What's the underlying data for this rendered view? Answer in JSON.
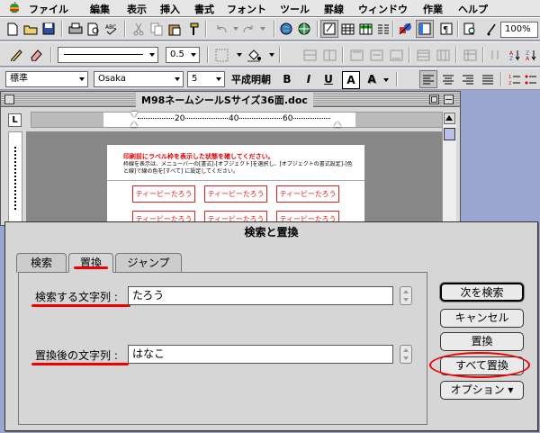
{
  "menubar": {
    "items": [
      "ファイル",
      "編集",
      "表示",
      "挿入",
      "書式",
      "フォント",
      "ツール",
      "罫線",
      "ウィンドウ",
      "作業",
      "ヘルプ"
    ]
  },
  "toolbar1": {
    "zoom": "100%"
  },
  "toolbar2": {
    "line_weight": "0.5"
  },
  "toolbar3": {
    "style": "標準",
    "font": "Osaka",
    "font_size": "5",
    "mincho_font": "平成明朝",
    "bold": "B",
    "italic": "I",
    "underline": "U",
    "outline": "A",
    "shadow": "A"
  },
  "document": {
    "title": "M98ネームシールSサイズ36面.doc",
    "instruction_line1": "印刷前にラベル枠を表示した状態を確してください。",
    "instruction_line2": "枠線を表示は、メニューバーの[書式]-[オブジェクト]を選択し、[オブジェクトの書式設定]-[色と線]で線の色を[すべて] に設定してください。",
    "label_text": "ティービーたろう",
    "ruler_ticks": [
      "20",
      "40",
      "60"
    ]
  },
  "dialog": {
    "title": "検索と置換",
    "tabs": [
      "検索",
      "置換",
      "ジャンプ"
    ],
    "search_label": "検索する文字列 :",
    "search_value": "たろう",
    "replace_label": "置換後の文字列 :",
    "replace_value": "はなこ",
    "buttons": {
      "find_next": "次を検索",
      "cancel": "キャンセル",
      "replace": "置換",
      "replace_all": "すべて置換",
      "options": "オプション ▾"
    }
  },
  "colors": {
    "highlight": "#e00000",
    "desktop": "#9aa6d0"
  }
}
